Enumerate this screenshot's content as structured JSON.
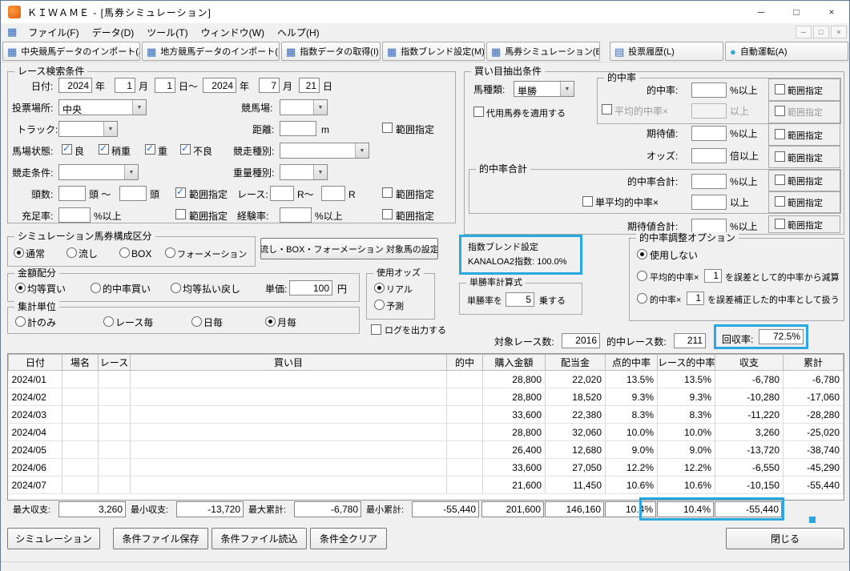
{
  "window": {
    "title": "ＫＩＷＡＭＥ - [馬券シミュレーション]"
  },
  "icons": {
    "grid": "▦",
    "list": "▤",
    "auto": "●",
    "combo_arrow": "▼",
    "check": "✓",
    "minimize": "─",
    "maximize": "□",
    "close": "×",
    "mdi_minimize": "─",
    "mdi_restore": "□",
    "mdi_close": "×",
    "doc": "▦"
  },
  "menubar": {
    "items": [
      "ファイル(F)",
      "データ(D)",
      "ツール(T)",
      "ウィンドウ(W)",
      "ヘルプ(H)"
    ]
  },
  "toolbar": {
    "buttons": [
      "中央競馬データのインポート(J)",
      "地方競馬データのインポート(N)",
      "指数データの取得(I)",
      "指数ブレンド設定(M)",
      "馬券シミュレーション(B)",
      "投票履歴(L)",
      "自動運転(A)"
    ]
  },
  "search": {
    "title": "レース検索条件",
    "date_label": "日付:",
    "from": {
      "year": "2024",
      "month": "1",
      "day": "1"
    },
    "to": {
      "year": "2024",
      "month": "7",
      "day": "21"
    },
    "units": {
      "year": "年",
      "month": "月",
      "day_range": "日～",
      "day": "日"
    },
    "venue_label": "投票場所:",
    "venue_value": "中央",
    "course_label": "競馬場:",
    "track_label": "トラック:",
    "distance_label": "距離:",
    "distance_unit": "m",
    "surface_label": "馬場状態:",
    "surface_options": [
      "良",
      "稍重",
      "重",
      "不良"
    ],
    "race_type_label": "競走種別:",
    "race_cond_label": "競走条件:",
    "weight_label": "重量種別:",
    "heads_label": "頭数:",
    "heads_mid": "頭 ～",
    "heads_unit": "頭",
    "race_no_label": "レース:",
    "race_no_mid": "R～",
    "race_no_unit": "R",
    "fill_label": "充足率:",
    "exp_label": "経験率:",
    "pct_min": "%以上",
    "range_label": "範囲指定"
  },
  "extract": {
    "title": "買い目抽出条件",
    "bet_type_label": "馬種類:",
    "bet_type_value": "単勝",
    "substitute_label": "代用馬券を適用する",
    "hit_group_title": "的中率",
    "hit_label": "的中率:",
    "avg_hit_label": "平均的中率×",
    "ge_label": "以上",
    "expect_label": "期待値:",
    "odds_label": "オッズ:",
    "odds_unit": "倍以上",
    "hit_total_group_title": "的中率合計",
    "hit_total_label": "的中率合計:",
    "single_avg_label": "単平均的中率×",
    "expect_total_label": "期待値合計:",
    "pct_min": "%以上",
    "range_label": "範囲指定"
  },
  "sim_type": {
    "title": "シミュレーション馬券構成区分",
    "options": [
      "通常",
      "流し",
      "BOX",
      "フォーメーション"
    ],
    "target_button": "流し・BOX・フォーメーション 対象馬の設定"
  },
  "index_blend": {
    "title": "指数ブレンド設定",
    "value": "KANALOA2指数: 100.0%"
  },
  "hit_adjust": {
    "title": "的中率調整オプション",
    "option_none": "使用しない",
    "option_avg_pre": "平均的中率×",
    "option_avg_value": "1",
    "option_avg_post": "を誤差として的中率から減算",
    "option_hit_pre": "的中率×",
    "option_hit_value": "1",
    "option_hit_post": "を誤差補正した的中率として扱う"
  },
  "amount": {
    "title": "金額配分",
    "options": [
      "均等買い",
      "的中率買い",
      "均等払い戻し"
    ],
    "unit_price_label": "単価:",
    "unit_price_value": "100",
    "unit_price_unit": "円"
  },
  "odds_use": {
    "title": "使用オッズ",
    "options": [
      "リアル",
      "予測"
    ]
  },
  "win_formula": {
    "title": "単勝率計算式",
    "pre": "単勝率を",
    "value": "5",
    "post": "乗する"
  },
  "aggregate": {
    "title": "集計単位",
    "options": [
      "計のみ",
      "レース毎",
      "日毎",
      "月毎"
    ]
  },
  "log_label": "ログを出力する",
  "summary": {
    "target_label": "対象レース数:",
    "target_value": "2016",
    "hit_label": "的中レース数:",
    "hit_value": "211",
    "recovery_label": "回収率:",
    "recovery_value": "72.5%"
  },
  "table": {
    "headers": [
      "日付",
      "場名",
      "レース",
      "買い目",
      "的中",
      "購入金額",
      "配当金",
      "点的中率",
      "レース的中率",
      "収支",
      "累計"
    ],
    "rows": [
      [
        "2024/01",
        "",
        "",
        "",
        "",
        "28,800",
        "22,020",
        "13.5%",
        "13.5%",
        "-6,780",
        "-6,780"
      ],
      [
        "2024/02",
        "",
        "",
        "",
        "",
        "28,800",
        "18,520",
        "9.3%",
        "9.3%",
        "-10,280",
        "-17,060"
      ],
      [
        "2024/03",
        "",
        "",
        "",
        "",
        "33,600",
        "22,380",
        "8.3%",
        "8.3%",
        "-11,220",
        "-28,280"
      ],
      [
        "2024/04",
        "",
        "",
        "",
        "",
        "28,800",
        "32,060",
        "10.0%",
        "10.0%",
        "3,260",
        "-25,020"
      ],
      [
        "2024/05",
        "",
        "",
        "",
        "",
        "26,400",
        "12,680",
        "9.0%",
        "9.0%",
        "-13,720",
        "-38,740"
      ],
      [
        "2024/06",
        "",
        "",
        "",
        "",
        "33,600",
        "27,050",
        "12.2%",
        "12.2%",
        "-6,550",
        "-45,290"
      ],
      [
        "2024/07",
        "",
        "",
        "",
        "",
        "21,600",
        "11,450",
        "10.6%",
        "10.6%",
        "-10,150",
        "-55,440"
      ]
    ]
  },
  "stats": {
    "max_balance_label": "最大収支:",
    "max_balance": "3,260",
    "min_balance_label": "最小収支:",
    "min_balance": "-13,720",
    "max_total_label": "最大累計:",
    "max_total": "-6,780",
    "min_total_label": "最小累計:",
    "min_total": "-55,440",
    "total_purchase": "201,600",
    "total_payout": "146,160",
    "total_point_rate": "10.4%",
    "total_race_rate": "10.4%",
    "total_balance": "-55,440"
  },
  "actions": {
    "simulate": "シミュレーション",
    "save": "条件ファイル保存",
    "load": "条件ファイル読込",
    "clear": "条件全クリア",
    "close": "閉じる"
  },
  "colors": {
    "highlight": "#29a8e0"
  }
}
